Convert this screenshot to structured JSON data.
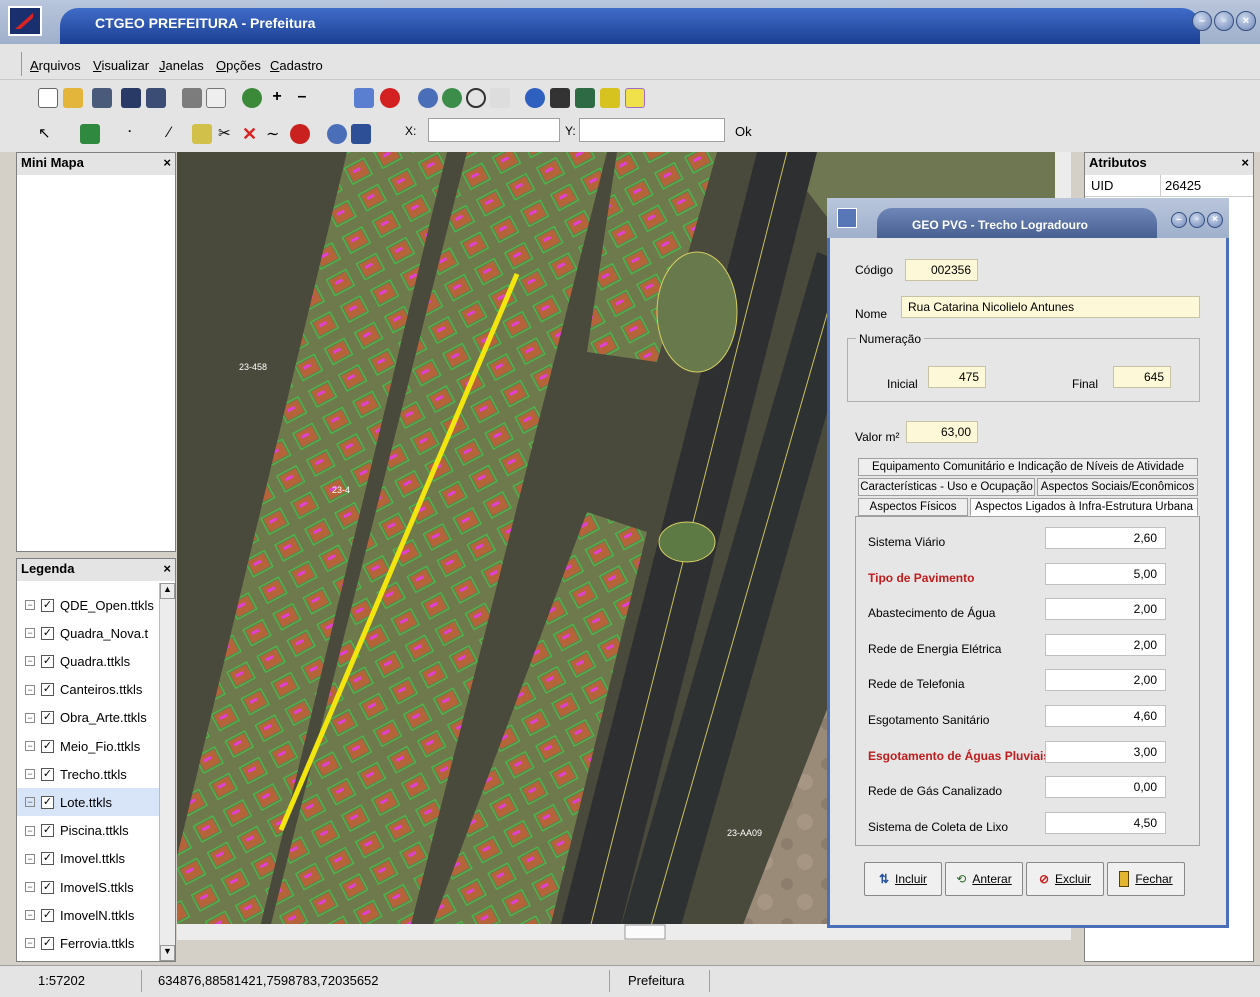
{
  "window": {
    "title": "CTGEO PREFEITURA - Prefeitura"
  },
  "menu": [
    "Arquivos",
    "Visualizar",
    "Janelas",
    "Opções",
    "Cadastro"
  ],
  "coords": {
    "x_label": "X:",
    "y_label": "Y:",
    "x_value": "",
    "y_value": "",
    "ok_label": "Ok"
  },
  "mini_map": {
    "title": "Mini Mapa",
    "close": "×"
  },
  "legend": {
    "title": "Legenda",
    "close": "×",
    "items": [
      "QDE_Open.ttkls",
      "Quadra_Nova.t",
      "Quadra.ttkls",
      "Canteiros.ttkls",
      "Obra_Arte.ttkls",
      "Meio_Fio.ttkls",
      "Trecho.ttkls",
      "Lote.ttkls",
      "Piscina.ttkls",
      "Imovel.ttkls",
      "ImovelS.ttkls",
      "ImovelN.ttkls",
      "Ferrovia.ttkls"
    ],
    "selected_index": 7
  },
  "attributes": {
    "title": "Atributos",
    "close": "×",
    "key": "UID",
    "value": "26425"
  },
  "map": {
    "labels": [
      "23-458",
      "23-4",
      "23-AA09"
    ]
  },
  "status": {
    "scale": "1:57202",
    "coordinates": "634876,88581421,7598783,72035652",
    "layer": "Prefeitura"
  },
  "dialog": {
    "title": "GEO PVG - Trecho Logradouro",
    "codigo_label": "Código",
    "codigo": "002356",
    "nome_label": "Nome",
    "nome": "Rua Catarina Nicolielo Antunes",
    "numeracao_label": "Numeração",
    "inicial_label": "Inicial",
    "inicial": "475",
    "final_label": "Final",
    "final": "645",
    "valor_label": "Valor m²",
    "valor": "63,00",
    "tabs_row1": [
      "Equipamento Comunitário e Indicação de Níveis de Atividade"
    ],
    "tabs_row2": [
      "Características - Uso e Ocupação",
      "Aspectos Sociais/Econômicos"
    ],
    "tabs_row3": [
      "Aspectos Físicos",
      "Aspectos Ligados à Infra-Estrutura Urbana"
    ],
    "rows": [
      {
        "label": "Sistema Viário",
        "value": "2,60",
        "red": false
      },
      {
        "label": "Tipo de Pavimento",
        "value": "5,00",
        "red": true
      },
      {
        "label": "Abastecimento de Água",
        "value": "2,00",
        "red": false
      },
      {
        "label": "Rede de Energia Elétrica",
        "value": "2,00",
        "red": false
      },
      {
        "label": "Rede de Telefonia",
        "value": "2,00",
        "red": false
      },
      {
        "label": "Esgotamento Sanitário",
        "value": "4,60",
        "red": false
      },
      {
        "label": "Esgotamento de Águas Pluviais",
        "value": "3,00",
        "red": true
      },
      {
        "label": "Rede de Gás Canalizado",
        "value": "0,00",
        "red": false
      },
      {
        "label": "Sistema de Coleta de Lixo",
        "value": "4,50",
        "red": false
      }
    ],
    "buttons": {
      "incluir": "Incluir",
      "alterar": "Anterar",
      "excluir": "Excluir",
      "fechar": "Fechar"
    }
  }
}
